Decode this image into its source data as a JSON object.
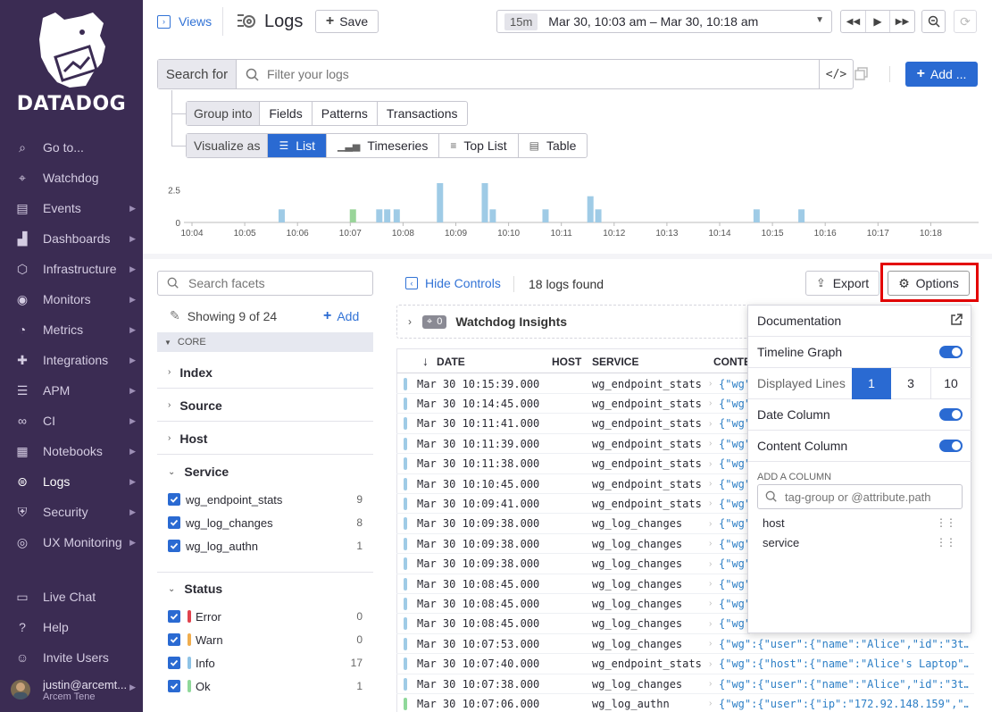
{
  "sidebar": {
    "brand": "DATADOG",
    "items": [
      {
        "label": "Go to...",
        "icon": "search-icon",
        "caret": false
      },
      {
        "label": "Watchdog",
        "icon": "binoculars-icon",
        "caret": false
      },
      {
        "label": "Events",
        "icon": "events-icon",
        "caret": true
      },
      {
        "label": "Dashboards",
        "icon": "dashboards-icon",
        "caret": true
      },
      {
        "label": "Infrastructure",
        "icon": "infrastructure-icon",
        "caret": true
      },
      {
        "label": "Monitors",
        "icon": "monitors-icon",
        "caret": true
      },
      {
        "label": "Metrics",
        "icon": "metrics-icon",
        "caret": true
      },
      {
        "label": "Integrations",
        "icon": "puzzle-icon",
        "caret": true
      },
      {
        "label": "APM",
        "icon": "apm-icon",
        "caret": true
      },
      {
        "label": "CI",
        "icon": "ci-icon",
        "caret": true
      },
      {
        "label": "Notebooks",
        "icon": "notebook-icon",
        "caret": true
      },
      {
        "label": "Logs",
        "icon": "logs-icon",
        "caret": true
      },
      {
        "label": "Security",
        "icon": "shield-icon",
        "caret": true
      },
      {
        "label": "UX Monitoring",
        "icon": "ux-icon",
        "caret": true
      }
    ],
    "bottom_items": [
      {
        "label": "Live Chat",
        "icon": "chat-icon"
      },
      {
        "label": "Help",
        "icon": "help-icon"
      },
      {
        "label": "Invite Users",
        "icon": "invite-icon"
      }
    ],
    "user": {
      "name": "justin@arcemt...",
      "org": "Arcem Tene"
    }
  },
  "header": {
    "views_label": "Views",
    "title": "Logs",
    "save_label": "Save",
    "time_badge": "15m",
    "time_range": "Mar 30, 10:03 am – Mar 30, 10:18 am"
  },
  "search": {
    "label": "Search for",
    "placeholder": "Filter your logs",
    "add_label": "Add ..."
  },
  "group_into": {
    "label": "Group into",
    "options": [
      "Fields",
      "Patterns",
      "Transactions"
    ]
  },
  "visualize_as": {
    "label": "Visualize as",
    "options": [
      "List",
      "Timeseries",
      "Top List",
      "Table"
    ],
    "selected": "List"
  },
  "chart_data": {
    "type": "bar",
    "y_ticks": [
      "2.5",
      "0"
    ],
    "ylim": [
      0,
      3
    ],
    "x_ticks": [
      "10:04",
      "10:05",
      "10:06",
      "10:07",
      "10:08",
      "10:09",
      "10:10",
      "10:11",
      "10:12",
      "10:13",
      "10:14",
      "10:15",
      "10:16",
      "10:17",
      "10:18"
    ],
    "bars": [
      {
        "t": 5.7,
        "v": 1,
        "color": "#9fcbe6"
      },
      {
        "t": 7.05,
        "v": 1,
        "color": "#9ad59a"
      },
      {
        "t": 7.55,
        "v": 1,
        "color": "#9fcbe6"
      },
      {
        "t": 7.7,
        "v": 1,
        "color": "#9fcbe6"
      },
      {
        "t": 7.88,
        "v": 1,
        "color": "#9fcbe6"
      },
      {
        "t": 8.7,
        "v": 3,
        "color": "#9fcbe6"
      },
      {
        "t": 9.55,
        "v": 3,
        "color": "#9fcbe6"
      },
      {
        "t": 9.7,
        "v": 1,
        "color": "#9fcbe6"
      },
      {
        "t": 10.7,
        "v": 1,
        "color": "#9fcbe6"
      },
      {
        "t": 11.55,
        "v": 2,
        "color": "#9fcbe6"
      },
      {
        "t": 11.7,
        "v": 1,
        "color": "#9fcbe6"
      },
      {
        "t": 14.7,
        "v": 1,
        "color": "#9fcbe6"
      },
      {
        "t": 15.55,
        "v": 1,
        "color": "#9fcbe6"
      }
    ]
  },
  "facets": {
    "search_placeholder": "Search facets",
    "showing": "Showing 9 of 24",
    "add_label": "Add",
    "core_label": "CORE",
    "groups": [
      "Index",
      "Source",
      "Host"
    ],
    "service": {
      "label": "Service",
      "items": [
        {
          "name": "wg_endpoint_stats",
          "count": "9"
        },
        {
          "name": "wg_log_changes",
          "count": "8"
        },
        {
          "name": "wg_log_authn",
          "count": "1"
        }
      ]
    },
    "status": {
      "label": "Status",
      "items": [
        {
          "name": "Error",
          "count": "0",
          "color": "#e0434e"
        },
        {
          "name": "Warn",
          "count": "0",
          "color": "#f0ad4e"
        },
        {
          "name": "Info",
          "count": "17",
          "color": "#8ec3e6"
        },
        {
          "name": "Ok",
          "count": "1",
          "color": "#8fd89a"
        }
      ]
    }
  },
  "results": {
    "hide_controls": "Hide Controls",
    "count_text": "18 logs found",
    "export_label": "Export",
    "options_label": "Options",
    "watchdog_count": "0",
    "watchdog_label": "Watchdog Insights",
    "columns": [
      "DATE",
      "HOST",
      "SERVICE",
      "CONTENT"
    ],
    "rows": [
      {
        "date": "Mar 30 10:15:39.000",
        "service": "wg_endpoint_stats",
        "content": "{\"wg\"",
        "status": "info"
      },
      {
        "date": "Mar 30 10:14:45.000",
        "service": "wg_endpoint_stats",
        "content": "{\"wg\"",
        "status": "info"
      },
      {
        "date": "Mar 30 10:11:41.000",
        "service": "wg_endpoint_stats",
        "content": "{\"wg\"",
        "status": "info"
      },
      {
        "date": "Mar 30 10:11:39.000",
        "service": "wg_endpoint_stats",
        "content": "{\"wg\"",
        "status": "info"
      },
      {
        "date": "Mar 30 10:11:38.000",
        "service": "wg_endpoint_stats",
        "content": "{\"wg\"",
        "status": "info"
      },
      {
        "date": "Mar 30 10:10:45.000",
        "service": "wg_endpoint_stats",
        "content": "{\"wg\"",
        "status": "info"
      },
      {
        "date": "Mar 30 10:09:41.000",
        "service": "wg_endpoint_stats",
        "content": "{\"wg\"",
        "status": "info"
      },
      {
        "date": "Mar 30 10:09:38.000",
        "service": "wg_log_changes",
        "content": "{\"wg\"",
        "status": "info"
      },
      {
        "date": "Mar 30 10:09:38.000",
        "service": "wg_log_changes",
        "content": "{\"wg\"",
        "status": "info"
      },
      {
        "date": "Mar 30 10:09:38.000",
        "service": "wg_log_changes",
        "content": "{\"wg\"",
        "status": "info"
      },
      {
        "date": "Mar 30 10:08:45.000",
        "service": "wg_log_changes",
        "content": "{\"wg\"",
        "status": "info"
      },
      {
        "date": "Mar 30 10:08:45.000",
        "service": "wg_log_changes",
        "content": "{\"wg\"",
        "status": "info"
      },
      {
        "date": "Mar 30 10:08:45.000",
        "service": "wg_log_changes",
        "content": "{\"wg\"",
        "status": "info"
      },
      {
        "date": "Mar 30 10:07:53.000",
        "service": "wg_log_changes",
        "content": "{\"wg\":{\"user\":{\"name\":\"Alice\",\"id\":\"3t…",
        "status": "info"
      },
      {
        "date": "Mar 30 10:07:40.000",
        "service": "wg_endpoint_stats",
        "content": "{\"wg\":{\"host\":{\"name\":\"Alice's Laptop\"…",
        "status": "info"
      },
      {
        "date": "Mar 30 10:07:38.000",
        "service": "wg_log_changes",
        "content": "{\"wg\":{\"user\":{\"name\":\"Alice\",\"id\":\"3t…",
        "status": "info"
      },
      {
        "date": "Mar 30 10:07:06.000",
        "service": "wg_log_authn",
        "content": "{\"wg\":{\"user\":{\"ip\":\"172.92.148.159\",\"…",
        "status": "ok"
      }
    ]
  },
  "options_panel": {
    "documentation": "Documentation",
    "timeline_graph": "Timeline Graph",
    "displayed_lines": "Displayed Lines",
    "line_options": [
      "1",
      "3",
      "10"
    ],
    "line_selected": "1",
    "date_column": "Date Column",
    "content_column": "Content Column",
    "add_column_label": "ADD A COLUMN",
    "add_column_placeholder": "tag-group or @attribute.path",
    "columns": [
      "host",
      "service"
    ]
  },
  "colors": {
    "sidebar": "#3b2c53",
    "accent": "#2a6ad2",
    "highlight": "#e30000"
  }
}
